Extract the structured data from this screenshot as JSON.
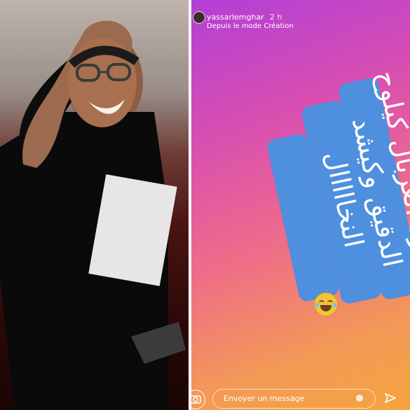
{
  "story": {
    "username": "yassarlemghar",
    "time": "2 h",
    "subtitle": "Depuis le mode Création",
    "text": "شطارة الغربال كيلوح الدقيق وكيشد النخااااال",
    "message_placeholder": "Envoyer un message"
  },
  "colors": {
    "accent_blue": "#4e8fde",
    "gradient_start": "#b23fd6",
    "gradient_end": "#f4a43f"
  },
  "icons": {
    "avatar": "avatar-icon",
    "camera": "camera-icon",
    "send": "send-icon",
    "emoji": "laughing-emoji-icon"
  }
}
